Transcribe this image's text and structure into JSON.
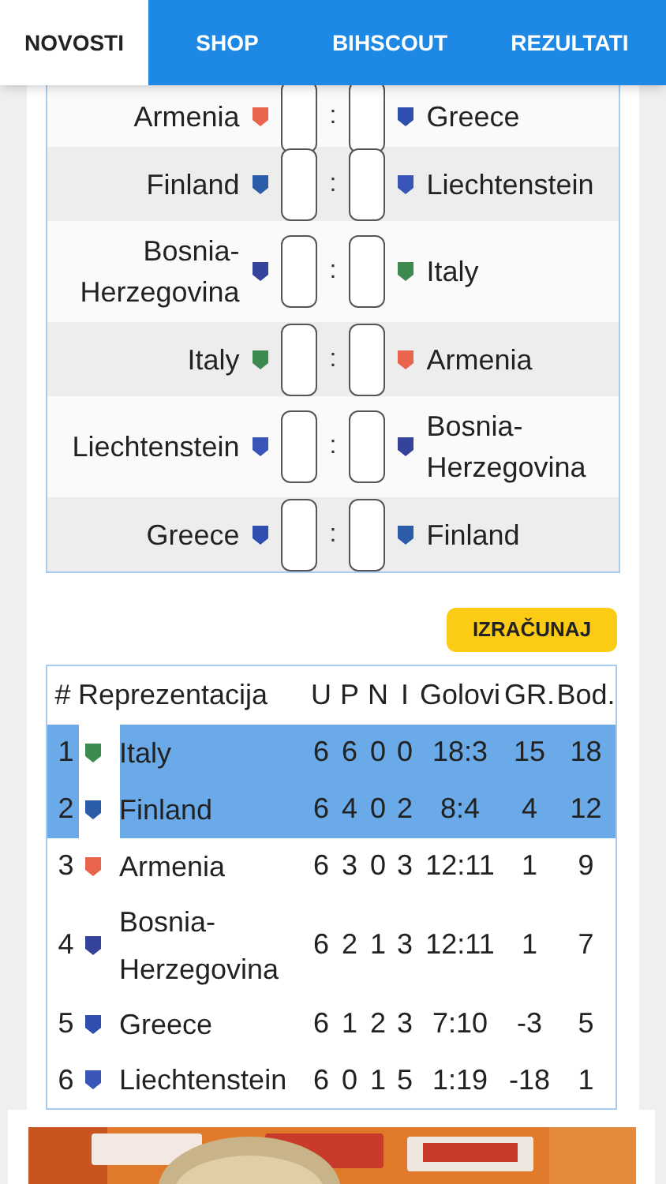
{
  "tabs": [
    {
      "label": "NOVOSTI",
      "selected": true
    },
    {
      "label": "SHOP",
      "selected": false
    },
    {
      "label": "BIHSCOUT",
      "selected": false
    },
    {
      "label": "REZULTATI",
      "selected": false
    }
  ],
  "fixtures": [
    {
      "home": {
        "name": "Armenia",
        "color": "#e8644c"
      },
      "separator": ":",
      "away": {
        "name": "Greece",
        "color": "#2f4fb0"
      }
    },
    {
      "home": {
        "name": "Finland",
        "color": "#2a5ca8"
      },
      "separator": ":",
      "away": {
        "name": "Liechtenstein",
        "color": "#3a55b8"
      }
    },
    {
      "home": {
        "name": "Bosnia-Herzegovina",
        "color": "#35449a"
      },
      "separator": ":",
      "away": {
        "name": "Italy",
        "color": "#3d8a4e"
      }
    },
    {
      "home": {
        "name": "Italy",
        "color": "#3d8a4e"
      },
      "separator": ":",
      "away": {
        "name": "Armenia",
        "color": "#e8644c"
      }
    },
    {
      "home": {
        "name": "Liechtenstein",
        "color": "#3a55b8"
      },
      "separator": ":",
      "away": {
        "name": "Bosnia-Herzegovina",
        "color": "#35449a"
      }
    },
    {
      "home": {
        "name": "Greece",
        "color": "#2f4fb0"
      },
      "separator": ":",
      "away": {
        "name": "Finland",
        "color": "#2a5ca8"
      }
    }
  ],
  "calculate_button": "IZRAČUNAJ",
  "standings": {
    "columns": [
      "#",
      "Reprezentacija",
      "U",
      "P",
      "N",
      "I",
      "Golovi",
      "GR.",
      "Bod."
    ],
    "rows": [
      {
        "selected": true,
        "color": "#3d8a4e",
        "cells": [
          "1",
          "Italy",
          "6",
          "6",
          "0",
          "0",
          "18:3",
          "15",
          "18"
        ]
      },
      {
        "selected": true,
        "color": "#2a5ca8",
        "cells": [
          "2",
          "Finland",
          "6",
          "4",
          "0",
          "2",
          "8:4",
          "4",
          "12"
        ]
      },
      {
        "selected": false,
        "color": "#e8644c",
        "cells": [
          "3",
          "Armenia",
          "6",
          "3",
          "0",
          "3",
          "12:11",
          "1",
          "9"
        ]
      },
      {
        "selected": false,
        "color": "#35449a",
        "cells": [
          "4",
          "Bosnia-Herzegovina",
          "6",
          "2",
          "1",
          "3",
          "12:11",
          "1",
          "7"
        ]
      },
      {
        "selected": false,
        "color": "#2f4fb0",
        "cells": [
          "5",
          "Greece",
          "6",
          "1",
          "2",
          "3",
          "7:10",
          "-3",
          "5"
        ]
      },
      {
        "selected": false,
        "color": "#3a55b8",
        "cells": [
          "6",
          "Liechtenstein",
          "6",
          "0",
          "1",
          "5",
          "1:19",
          "-18",
          "1"
        ]
      }
    ]
  }
}
